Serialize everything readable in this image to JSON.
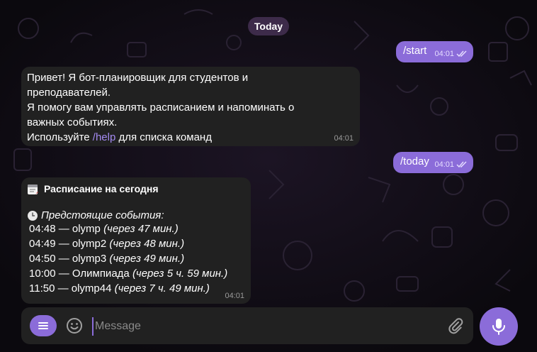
{
  "date_pill": "Today",
  "messages": {
    "start": {
      "text": "/start",
      "time": "04:01"
    },
    "greeting": {
      "lines": [
        "Привет! Я бот-планировщик для студентов и",
        "преподавателей.",
        "Я помогу вам управлять расписанием и напоминать о",
        "важных событиях."
      ],
      "last_prefix": "Используйте ",
      "link": "/help",
      "last_suffix": " для списка команд",
      "time": "04:01"
    },
    "today": {
      "text": "/today",
      "time": "04:01"
    },
    "schedule": {
      "title": "Расписание на сегодня",
      "upcoming_label": "Предстоящие события:",
      "events": [
        {
          "main": "04:48 — olymp",
          "rel": "(через 47 мин.)"
        },
        {
          "main": "04:49 — olymp2",
          "rel": "(через 48 мин.)"
        },
        {
          "main": "04:50 — olymp3",
          "rel": "(через 49 мин.)"
        },
        {
          "main": "10:00 — Олимпиада",
          "rel": "(через 5 ч. 59 мин.)"
        },
        {
          "main": "11:50 — olymp44",
          "rel": "(через 7 ч. 49 мин.)"
        }
      ],
      "time": "04:01"
    }
  },
  "composer": {
    "placeholder": "Message"
  },
  "icons": {
    "menu": "menu-icon",
    "emoji": "emoji-icon",
    "attach": "paperclip-icon",
    "mic": "microphone-icon",
    "read": "double-check-icon",
    "calendar": "calendar-icon",
    "clock": "clock-icon"
  },
  "colors": {
    "accent": "#8b6cd9",
    "incoming_bubble": "#212121",
    "background": "#0e0b12",
    "link": "#a48bf2"
  }
}
